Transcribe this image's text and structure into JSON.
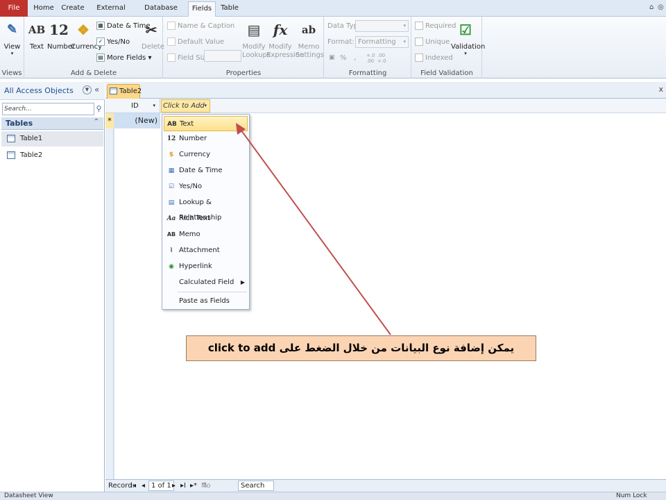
{
  "ribbon_tabs": [
    "File",
    "Home",
    "Create",
    "External Data",
    "Database Tools",
    "Fields",
    "Table"
  ],
  "window_controls": {
    "help": "⌂",
    "minimize": "◎"
  },
  "ribbon": {
    "views": {
      "view": "View",
      "group": "Views"
    },
    "add_delete": {
      "text": "Text",
      "number": "Number",
      "currency": "Currency",
      "date_time": "Date & Time",
      "yes_no": "Yes/No",
      "more_fields": "More Fields",
      "delete": "Delete",
      "group": "Add & Delete",
      "text_icon": "AB",
      "number_icon": "12"
    },
    "properties": {
      "name_caption": "Name & Caption",
      "default_value": "Default Value",
      "field_size": "Field Size",
      "modify_lookups_1": "Modify",
      "modify_lookups_2": "Lookups",
      "modify_expression_1": "Modify",
      "modify_expression_2": "Expression",
      "memo_settings_1": "Memo",
      "memo_settings_2": "Settings",
      "fx_icon": "fx",
      "ab_icon": "ab",
      "group": "Properties"
    },
    "formatting": {
      "data_type": "Data Type:",
      "format": "Format:",
      "format_value": "Formatting",
      "percent": "%",
      "comma": ",",
      "inc": "+.0 .00",
      "dec": ".00 +.0",
      "group": "Formatting"
    },
    "validation": {
      "required": "Required",
      "unique": "Unique",
      "indexed": "Indexed",
      "validation": "Validation",
      "group": "Field Validation"
    }
  },
  "nav": {
    "title": "All Access Objects",
    "search_placeholder": "Search...",
    "section": "Tables",
    "items": [
      "Table1",
      "Table2"
    ]
  },
  "document": {
    "tab": "Table2",
    "close": "x",
    "id_header": "ID",
    "add_header": "Click to Add",
    "new_row_marker": "*",
    "new_row_value": "(New)"
  },
  "menu": {
    "items": [
      {
        "icon": "AB",
        "label": "Text"
      },
      {
        "icon": "12",
        "label": "Number"
      },
      {
        "icon": "$",
        "label": "Currency"
      },
      {
        "icon": "▦",
        "label": "Date & Time"
      },
      {
        "icon": "☑",
        "label": "Yes/No"
      },
      {
        "icon": "▤",
        "label": "Lookup & Relationship"
      },
      {
        "icon": "Aa",
        "label": "Rich Text"
      },
      {
        "icon": "AB",
        "label": "Memo"
      },
      {
        "icon": "⌇",
        "label": "Attachment"
      },
      {
        "icon": "◉",
        "label": "Hyperlink"
      },
      {
        "icon": "",
        "label": "Calculated Field",
        "submenu": "▶"
      }
    ],
    "paste": "Paste as Fields"
  },
  "callout": "يمكن إضافة نوع البيانات من خلال الضغط على click to add",
  "record_nav": {
    "label": "Record:",
    "first": "I◂",
    "prev": "◂",
    "current": "1 of 1",
    "next": "▸",
    "last": "▸I",
    "new": "▸*",
    "filter": "No Filter",
    "search": "Search"
  },
  "status": {
    "left": "Datasheet View",
    "right": "Num Lock"
  },
  "colors": {
    "file_tab": "#c0322e",
    "highlight": "#fde08a",
    "arrow": "#c0504d",
    "callout": "#fbd4b4"
  }
}
